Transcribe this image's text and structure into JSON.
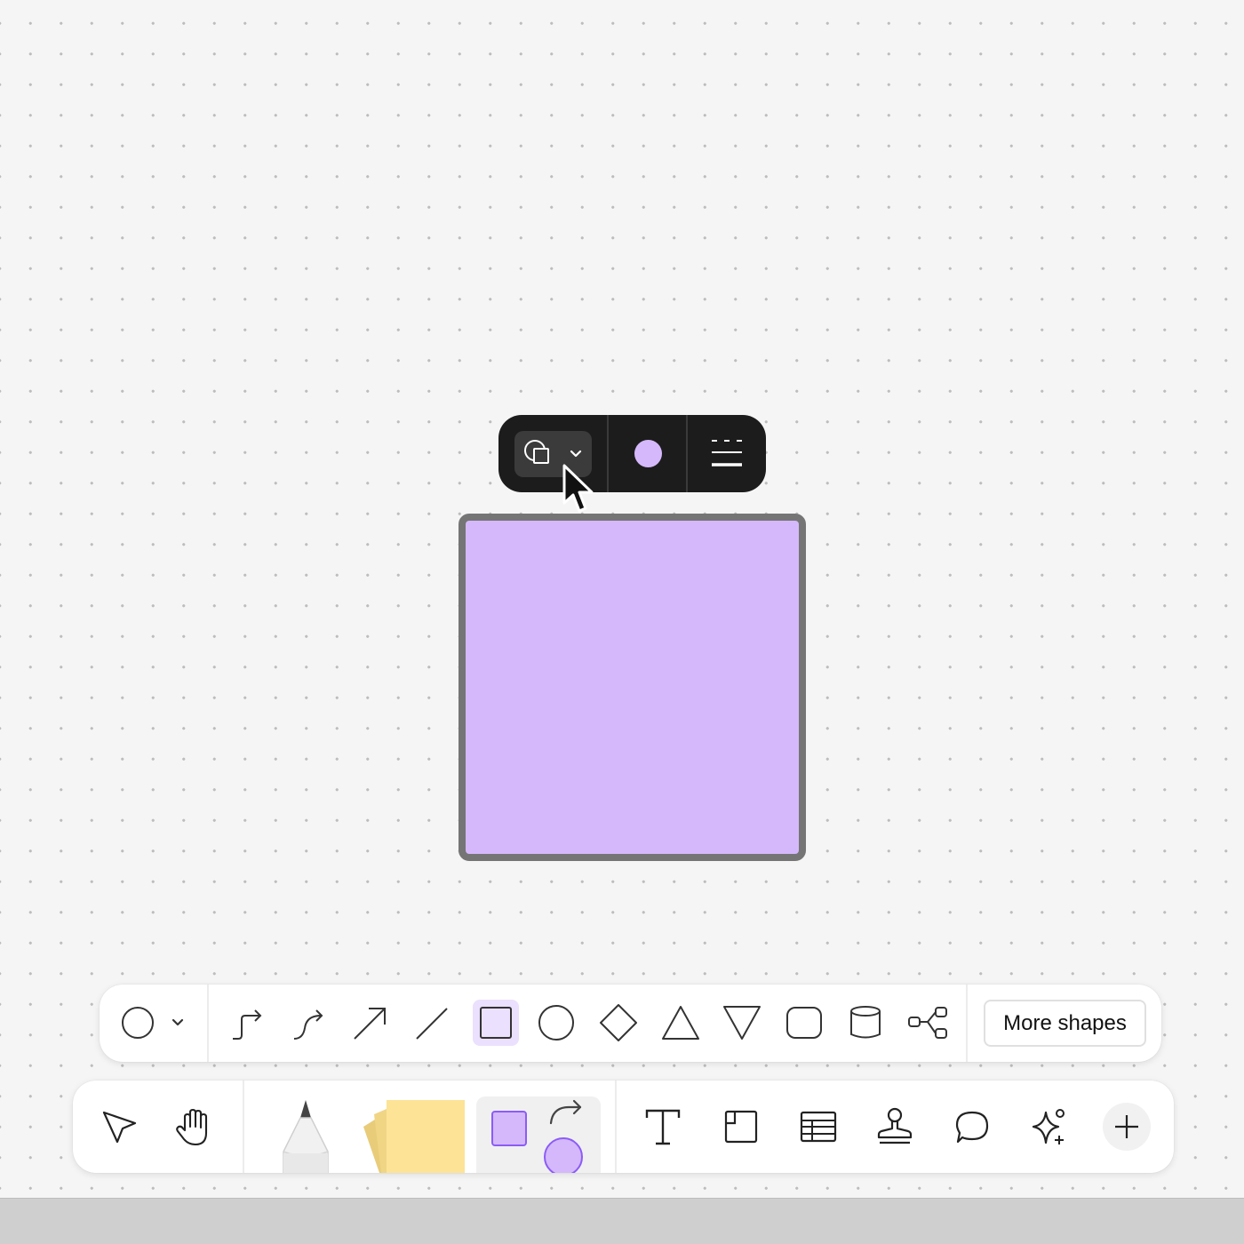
{
  "canvas": {
    "background_color": "#f5f5f5",
    "dot_color": "#bdbdbd"
  },
  "selected_shape": {
    "type": "square",
    "fill_color": "#d5b8fb",
    "stroke_color": "#757575"
  },
  "context_toolbar": {
    "background_color": "#1c1c1c",
    "items": [
      {
        "name": "shape-type",
        "icon": "shapes-icon",
        "has_dropdown": true,
        "hovered": true
      },
      {
        "name": "fill-color",
        "icon": "color-dot",
        "color": "#d5b8fb"
      },
      {
        "name": "stroke-style",
        "icon": "stroke-style-icon"
      }
    ]
  },
  "shapes_bar": {
    "current_shape_icon": "circle-icon",
    "tools": [
      {
        "name": "elbow-connector",
        "icon": "elbow-connector-icon"
      },
      {
        "name": "curved-connector",
        "icon": "curved-connector-icon"
      },
      {
        "name": "arrow",
        "icon": "arrow-icon"
      },
      {
        "name": "line",
        "icon": "line-icon"
      },
      {
        "name": "square",
        "icon": "square-icon",
        "selected": true
      },
      {
        "name": "circle",
        "icon": "circle-icon"
      },
      {
        "name": "diamond",
        "icon": "diamond-icon"
      },
      {
        "name": "triangle",
        "icon": "triangle-icon"
      },
      {
        "name": "triangle-down",
        "icon": "triangle-down-icon"
      },
      {
        "name": "rounded-rectangle",
        "icon": "rounded-rectangle-icon"
      },
      {
        "name": "cylinder",
        "icon": "cylinder-icon"
      },
      {
        "name": "tree",
        "icon": "tree-icon"
      }
    ],
    "more_shapes_label": "More shapes",
    "selected_color": "#ebe0fd"
  },
  "main_toolbar": {
    "tools": [
      {
        "name": "select",
        "icon": "pointer-icon"
      },
      {
        "name": "hand",
        "icon": "hand-icon"
      },
      {
        "name": "pen",
        "icon": "pen-icon"
      },
      {
        "name": "sticky-note",
        "icon": "sticky-note-icon",
        "color": "#fde396"
      },
      {
        "name": "shapes",
        "icon": "shapes-connectors-icon",
        "active": true
      },
      {
        "name": "text",
        "icon": "text-icon"
      },
      {
        "name": "section",
        "icon": "section-icon"
      },
      {
        "name": "table",
        "icon": "table-icon"
      },
      {
        "name": "stamp",
        "icon": "stamp-icon"
      },
      {
        "name": "comment",
        "icon": "comment-icon"
      },
      {
        "name": "ai",
        "icon": "sparkle-icon"
      },
      {
        "name": "add-more",
        "icon": "plus-icon"
      }
    ]
  }
}
